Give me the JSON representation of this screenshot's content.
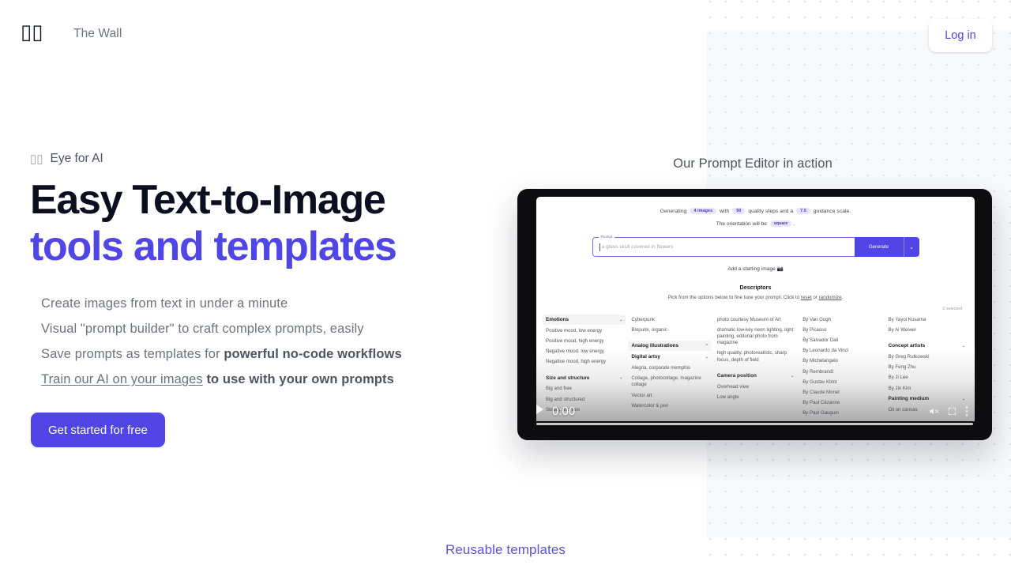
{
  "header": {
    "logo_icon": "eye-logo-glyph",
    "logo_glyph": "▯▯",
    "brand_name": "The Wall",
    "login_label": "Log in"
  },
  "hero": {
    "eyebrow_icon": "▯▯",
    "eyebrow": "Eye for AI",
    "headline_line1": "Easy Text-to-Image",
    "headline_line2": "tools and templates",
    "bullets": [
      {
        "text": "Create images from text in under a minute"
      },
      {
        "text": "Visual \"prompt builder\" to craft complex prompts, easily"
      },
      {
        "prefix": "Save prompts as templates for ",
        "bold": "powerful no-code workflows"
      },
      {
        "link": "Train our AI on your images",
        "bold": " to use with your own prompts"
      }
    ],
    "cta_label": "Get started for free"
  },
  "video": {
    "caption": "Our Prompt Editor in action",
    "time": "0:00",
    "play_icon": "play-icon",
    "mute_icon": "mute-icon",
    "fullscreen_icon": "fullscreen-icon",
    "more_icon": "more-options-icon"
  },
  "app": {
    "generating_prefix": "Generating",
    "chip_images": "4 images",
    "generating_mid": "with",
    "chip_steps": "50",
    "generating_mid2": "quality steps and a",
    "chip_guidance": "7.5",
    "generating_suffix": "guidance scale.",
    "orientation_prefix": "The orientation will be",
    "chip_orientation": "square",
    "orientation_suffix": ".",
    "prompt_label": "Prompt",
    "prompt_value": "a glass skull covered in flowers",
    "generate_label": "Generate",
    "generate_caret": "⌄",
    "starting_image": "Add a starting image",
    "camera_icon": "📷",
    "descriptors_title": "Descriptors",
    "descriptors_sub_a": "Pick from the options below to fine tune your prompt. Click to ",
    "descriptors_sub_reset": "reset",
    "descriptors_sub_or": " or ",
    "descriptors_sub_randomize": "randomize",
    "descriptors_sub_end": ".",
    "selected_count": "0 selected",
    "columns": [
      {
        "blocks": [
          {
            "type": "header",
            "label": "Emotions",
            "chev": "⌄",
            "highlight": true
          },
          {
            "type": "opt",
            "label": "Positive mood, low energy"
          },
          {
            "type": "opt",
            "label": "Positive mood, high energy"
          },
          {
            "type": "opt",
            "label": "Negative mood, low energy"
          },
          {
            "type": "opt",
            "label": "Negative mood, high energy"
          },
          {
            "type": "spacer"
          },
          {
            "type": "header",
            "label": "Size and structure",
            "chev": "⌄",
            "highlight": false
          },
          {
            "type": "opt",
            "label": "Big and free"
          },
          {
            "type": "opt",
            "label": "Big and structured"
          },
          {
            "type": "opt",
            "label": "Steady and free"
          }
        ]
      },
      {
        "blocks": [
          {
            "type": "opt",
            "label": "Cyberpunk"
          },
          {
            "type": "opt",
            "label": "Biopunk, organic"
          },
          {
            "type": "spacer"
          },
          {
            "type": "header",
            "label": "Analog illustrations",
            "chev": "⌃",
            "highlight": true
          },
          {
            "type": "header",
            "label": "Digital artsy",
            "chev": "⌄",
            "highlight": false
          },
          {
            "type": "opt",
            "label": "Alegria, corporate memphis"
          },
          {
            "type": "opt",
            "label": "Collage, photocollage, magazine collage"
          },
          {
            "type": "opt",
            "label": "Vector art"
          },
          {
            "type": "opt",
            "label": "Watercolor & pen"
          }
        ]
      },
      {
        "blocks": [
          {
            "type": "opt",
            "label": "photo courtesy Museum of Art"
          },
          {
            "type": "opt",
            "label": "dramatic low-key neon lighting, light painting, editorial photo from magazine"
          },
          {
            "type": "opt",
            "label": "high quality, photorealistic, sharp focus, depth of field"
          },
          {
            "type": "spacer"
          },
          {
            "type": "header",
            "label": "Camera position",
            "chev": "⌄",
            "highlight": false
          },
          {
            "type": "opt",
            "label": "Overhead view"
          },
          {
            "type": "opt",
            "label": "Low angle"
          }
        ]
      },
      {
        "blocks": [
          {
            "type": "opt",
            "label": "By Van Gogh"
          },
          {
            "type": "opt",
            "label": "By Picasso"
          },
          {
            "type": "opt",
            "label": "By Salvador Dali"
          },
          {
            "type": "opt",
            "label": "By Leonardo da Vinci"
          },
          {
            "type": "opt",
            "label": "By Michelangelo"
          },
          {
            "type": "opt",
            "label": "By Rembrandt"
          },
          {
            "type": "opt",
            "label": "By Gustav Klimt"
          },
          {
            "type": "opt",
            "label": "By Claude Monet"
          },
          {
            "type": "opt",
            "label": "By Paul Cézanne"
          },
          {
            "type": "opt",
            "label": "By Paul Gauguin"
          }
        ]
      },
      {
        "blocks": [
          {
            "type": "opt",
            "label": "By Yayoi Kusama"
          },
          {
            "type": "opt",
            "label": "By Ai Weiwei"
          },
          {
            "type": "spacer"
          },
          {
            "type": "header",
            "label": "Concept artists",
            "chev": "⌄",
            "highlight": false
          },
          {
            "type": "opt",
            "label": "By Greg Rutkowski"
          },
          {
            "type": "opt",
            "label": "By Feng Zhu"
          },
          {
            "type": "opt",
            "label": "By Ji Lee"
          },
          {
            "type": "opt",
            "label": "By Jin Kim"
          },
          {
            "type": "header",
            "label": "Painting medium",
            "chev": "⌄",
            "highlight": false
          },
          {
            "type": "opt",
            "label": "Oil on canvas"
          }
        ]
      }
    ]
  },
  "footer": {
    "label": "Reusable templates"
  },
  "colors": {
    "accent": "#4f46e5",
    "accent_soft": "#5b53d8",
    "heading": "#0b1020",
    "muted": "#6b7280",
    "panel": "#f7f9fb",
    "dot": "#e3e5e9"
  }
}
